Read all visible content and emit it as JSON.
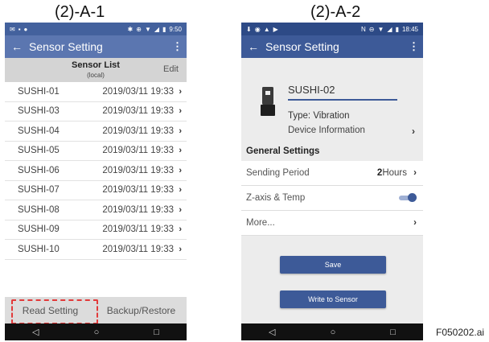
{
  "figure": {
    "caption_left": "(2)-A-1",
    "caption_right": "(2)-A-2",
    "label": "F050202.ai"
  },
  "colors": {
    "appbar_left": "#5b76b0",
    "appbar_right": "#3d5a98",
    "highlight": "#e23a3a"
  },
  "phone1": {
    "status": {
      "time": "9:50"
    },
    "appbar": {
      "title": "Sensor Setting"
    },
    "list_header": {
      "title": "Sensor List",
      "subtitle": "(local)",
      "edit": "Edit"
    },
    "rows": [
      {
        "name": "SUSHI-01",
        "date": "2019/03/11  19:33"
      },
      {
        "name": "SUSHI-03",
        "date": "2019/03/11  19:33"
      },
      {
        "name": "SUSHI-04",
        "date": "2019/03/11  19:33"
      },
      {
        "name": "SUSHI-05",
        "date": "2019/03/11  19:33"
      },
      {
        "name": "SUSHI-06",
        "date": "2019/03/11  19:33"
      },
      {
        "name": "SUSHI-07",
        "date": "2019/03/11  19:33"
      },
      {
        "name": "SUSHI-08",
        "date": "2019/03/11  19:33"
      },
      {
        "name": "SUSHI-09",
        "date": "2019/03/11  19:33"
      },
      {
        "name": "SUSHI-10",
        "date": "2019/03/11  19:33"
      }
    ],
    "bottom": {
      "read": "Read Setting",
      "backup": "Backup/Restore"
    }
  },
  "phone2": {
    "status": {
      "time": "18:45"
    },
    "appbar": {
      "title": "Sensor Setting"
    },
    "device": {
      "name": "SUSHI-02",
      "type": "Type: Vibration",
      "info": "Device Information"
    },
    "general": {
      "title": "General Settings",
      "sending_label": "Sending Period",
      "sending_num": "2",
      "sending_unit": "Hours",
      "zaxis_label": "Z-axis & Temp",
      "zaxis_on": true,
      "more_label": "More..."
    },
    "buttons": {
      "save": "Save",
      "write": "Write to Sensor"
    }
  }
}
